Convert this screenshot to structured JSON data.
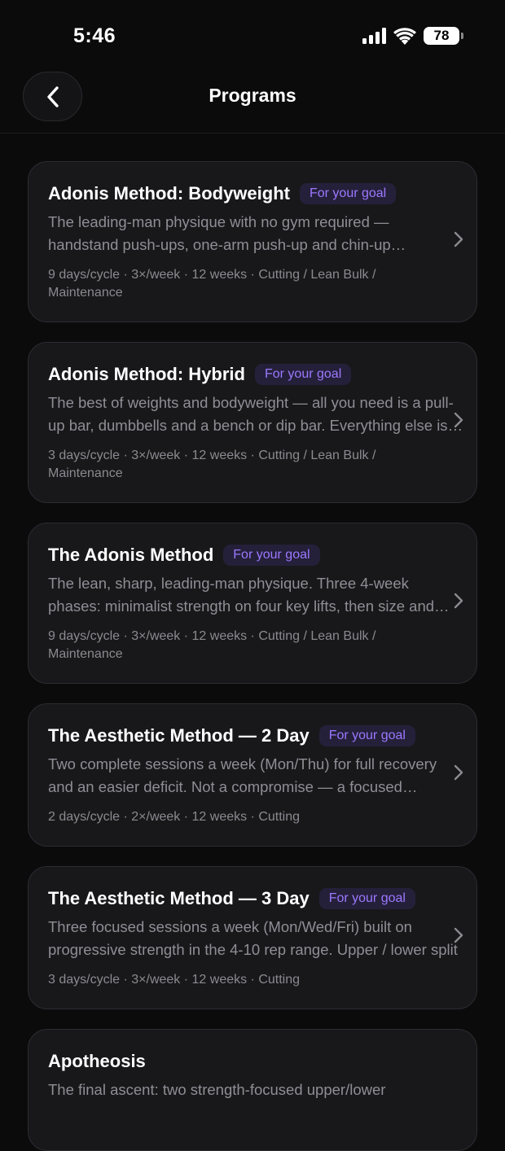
{
  "status": {
    "time": "5:46",
    "battery": "78"
  },
  "nav": {
    "title": "Programs"
  },
  "programs": [
    {
      "title": "Adonis Method: Bodyweight",
      "badge": "For your goal",
      "description": "The leading-man physique with no gym required — handstand push-ups, one-arm push-up and chin-up progressions built into a complete program for every level",
      "meta": "9 days/cycle · 3×/week · 12 weeks · Cutting / Lean Bulk / Maintenance"
    },
    {
      "title": "Adonis Method: Hybrid",
      "badge": "For your goal",
      "description": "The best of weights and bodyweight — all you need is a pull-up bar, dumbbells and a bench or dip bar. Everything else is progressive calisthenics",
      "meta": "3 days/cycle · 3×/week · 12 weeks · Cutting / Lean Bulk / Maintenance"
    },
    {
      "title": "The Adonis Method",
      "badge": "For your goal",
      "description": "The lean, sharp, leading-man physique. Three 4-week phases: minimalist strength on four key lifts, then size and detail work",
      "meta": "9 days/cycle · 3×/week · 12 weeks · Cutting / Lean Bulk / Maintenance"
    },
    {
      "title": "The Aesthetic Method — 2 Day",
      "badge": "For your goal",
      "description": "Two complete sessions a week (Mon/Thu) for full recovery and an easier deficit. Not a compromise — a focused approach",
      "meta": "2 days/cycle · 2×/week · 12 weeks · Cutting"
    },
    {
      "title": "The Aesthetic Method — 3 Day",
      "badge": "For your goal",
      "description": "Three focused sessions a week (Mon/Wed/Fri) built on progressive strength in the 4-10 rep range. Upper / lower split",
      "meta": "3 days/cycle · 3×/week · 12 weeks · Cutting"
    },
    {
      "title": "Apotheosis",
      "badge": "",
      "description": "The final ascent: two strength-focused upper/lower",
      "meta": ""
    }
  ],
  "colors": {
    "accent": "#9b78ff",
    "background": "#0b0b0c",
    "card": "#18181b"
  },
  "icons": {
    "back": "chevron-left-icon",
    "row": "chevron-right-icon"
  }
}
